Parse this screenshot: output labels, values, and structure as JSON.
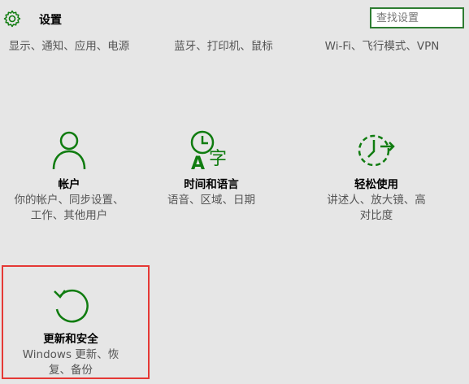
{
  "header": {
    "title": "设置",
    "search_placeholder": "查找设置"
  },
  "top_row": [
    {
      "desc": "显示、通知、应用、电源"
    },
    {
      "desc": "蓝牙、打印机、鼠标"
    },
    {
      "desc": "Wi-Fi、飞行模式、VPN"
    }
  ],
  "tiles": [
    {
      "label": "帐户",
      "desc": "你的帐户、同步设置、工作、其他用户",
      "icon": "person-icon"
    },
    {
      "label": "时间和语言",
      "desc": "语音、区域、日期",
      "icon": "time-language-icon"
    },
    {
      "label": "轻松使用",
      "desc": "讲述人、放大镜、高对比度",
      "icon": "ease-of-access-icon"
    },
    {
      "label": "更新和安全",
      "desc": "Windows 更新、恢复、备份",
      "icon": "update-icon",
      "selected": true
    }
  ],
  "colors": {
    "accent": "#107c10",
    "selection": "#e53935",
    "background": "#e6e6e6"
  }
}
